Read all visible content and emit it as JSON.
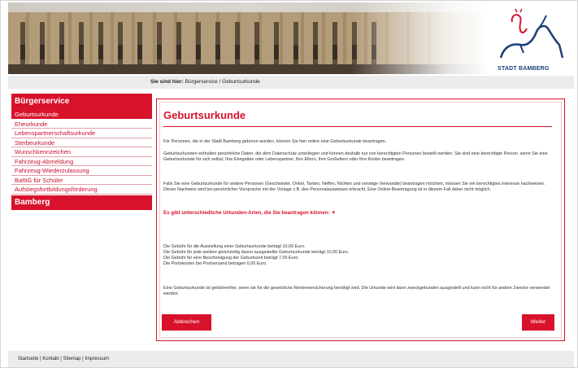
{
  "logo": {
    "text": "STADT BAMBERG"
  },
  "breadcrumb": {
    "label": "Sie sind hier:",
    "path": "Bürgerservice / Geburtsurkunde"
  },
  "sidebar": {
    "header": "Bürgerservice",
    "items": [
      {
        "label": "Geburtsurkunde",
        "active": true
      },
      {
        "label": "Eheurkunde"
      },
      {
        "label": "Lebenspartnerschaftsurkunde"
      },
      {
        "label": "Sterbeurkunde"
      },
      {
        "label": "Wunschkennzeichen"
      },
      {
        "label": "Fahrzeug-Abmeldung"
      },
      {
        "label": "Fahrzeug-Wiederzulassung"
      },
      {
        "label": "BaföG für Schüler"
      },
      {
        "label": "Aufstiegsfortbildungsförderung"
      }
    ],
    "footer": "Bamberg"
  },
  "main": {
    "title": "Geburtsurkunde",
    "p1": "Für Personen, die in der Stadt Bamberg geboren wurden, können Sie hier online eine Geburtsurkunde beantragen.",
    "p2": "Geburtsurkunden enthalten persönliche Daten, die dem Datenschutz unterliegen und können deshalb nur von berechtigten Personen bestellt werden. Sie sind eine berechtigte Person, wenn Sie eine Geburtsurkunde für sich selbst, Ihre Ehegatten oder Lebenspartner, Ihre Eltern, Ihre Großeltern oder Ihre Kinder beantragen.",
    "p3": "Falls Sie eine Geburtsurkunde für andere Personen (Geschwister, Onkel, Tanten, Neffen, Nichten und sonstige Verwandte) beantragen möchten, müssen Sie ein berechtigtes Interesse nachweisen. Dieser Nachweis wird bei persönlicher Vorsprache mit der Vorlage z.B. des Personalausweises erbracht. Eine Online-Beantragung ist in diesem Fall daher nicht möglich.",
    "notice": "Es gibt unterschiedliche Urkunden-Arten, die Sie beantragen können: ▼",
    "fees": [
      "Die Gebühr für die Ausstellung einer Geburtsurkunde beträgt 10,00 Euro.",
      "Die Gebühr für jede weitere gleichzeitig davon ausgestellte Geburtsurkunde beträgt 10,00 Euro.",
      "Die Gebühr für eine Bescheinigung der Geburtszeit beträgt 7,00 Euro.",
      "Die Portokosten bei Postversand betragen 0,00 Euro."
    ],
    "p4": "Eine Geburtsurkunde ist gebührenfrei, wenn sie für die gesetzliche Rentenversicherung benötigt wird. Die Urkunde wird dann zweckgebunden ausgestellt und kann nicht für andere Zwecke verwendet werden.",
    "cancel_label": "Abbrechen",
    "next_label": "Weiter"
  },
  "footer": {
    "links": "Startseite | Kontakt | Sitemap | Impressum"
  },
  "colors": {
    "accent": "#d8122b",
    "logo_blue": "#1b3f7a"
  }
}
